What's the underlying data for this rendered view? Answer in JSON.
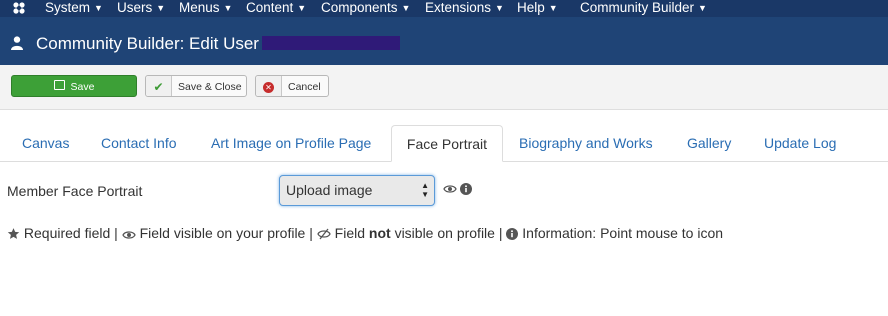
{
  "menubar": {
    "items": [
      "System",
      "Users",
      "Menus",
      "Content",
      "Components",
      "Extensions",
      "Help",
      "Community Builder"
    ],
    "logo_icon": "joomla-logo-icon"
  },
  "header": {
    "title": "Community Builder: Edit User",
    "icon": "user-icon"
  },
  "toolbar": {
    "save_label": "Save",
    "save_close_label": "Save & Close",
    "cancel_label": "Cancel"
  },
  "tabs": [
    "Canvas",
    "Contact Info",
    "Art Image on Profile Page",
    "Face Portrait",
    "Biography and Works",
    "Gallery",
    "Update Log"
  ],
  "active_tab": "Face Portrait",
  "form": {
    "field_label": "Member Face Portrait",
    "select_value": "Upload image"
  },
  "legend": {
    "required": "Required field",
    "sep1": "|",
    "visible": "Field visible on your profile",
    "sep2": "|",
    "not_visible_pre": "Field",
    "not_visible_bold": "not",
    "not_visible_post": "visible on profile",
    "sep3": "|",
    "info": "Information: Point mouse to icon"
  },
  "colors": {
    "menubar_bg": "#1a3867",
    "header_bg": "#1f4476",
    "save_green": "#3da037",
    "link_blue": "#2a6db3"
  }
}
